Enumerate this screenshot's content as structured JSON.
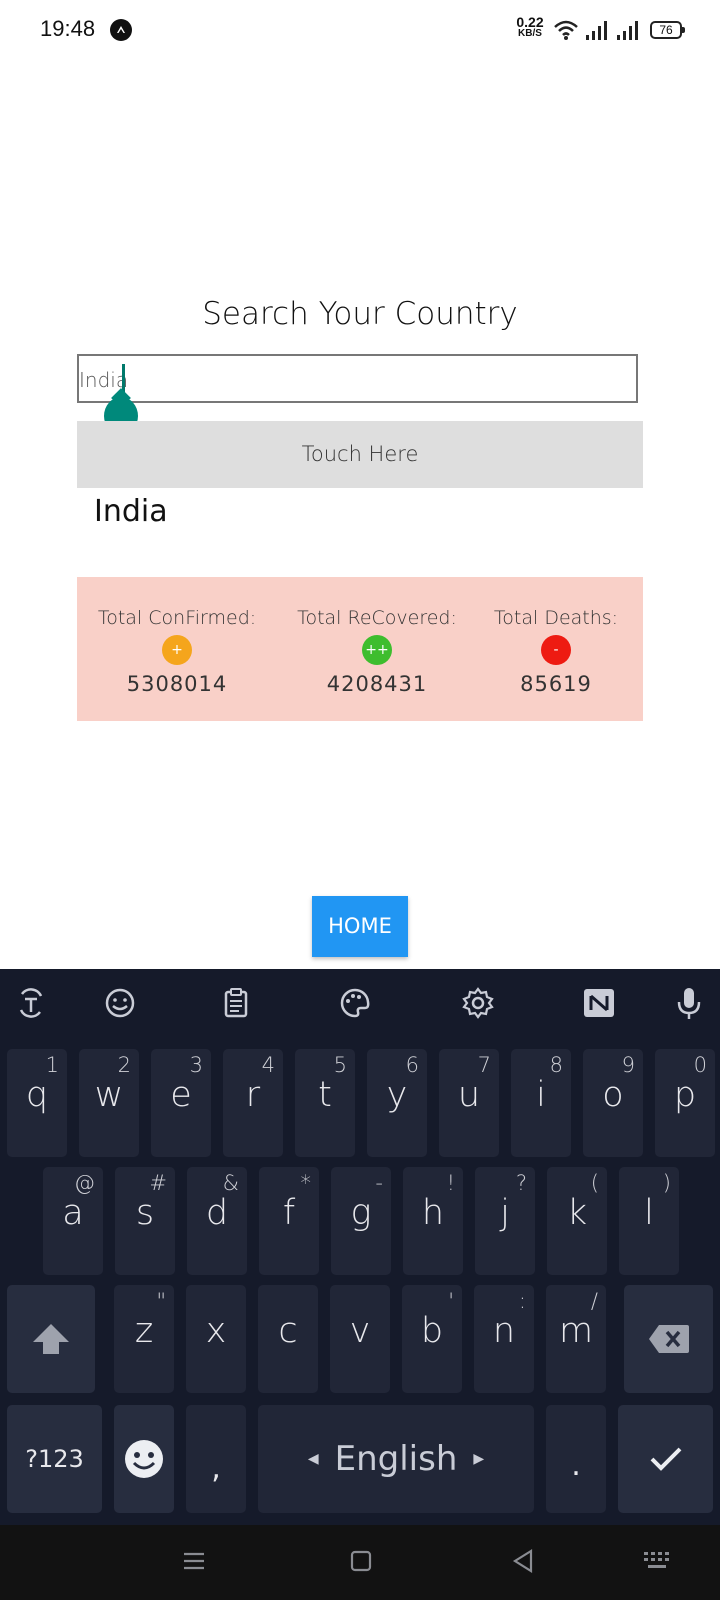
{
  "status_bar": {
    "time": "19:48",
    "speed_value": "0.22",
    "speed_unit": "KB/S",
    "battery": "76"
  },
  "app": {
    "title": "Search Your Country",
    "search": {
      "value": "India"
    },
    "touch_button": "Touch Here",
    "result_country": "India",
    "stats": [
      {
        "label": "Total ConFirmed:",
        "symbol": "+",
        "color": "#f5a51c",
        "value": "5308014"
      },
      {
        "label": "Total ReCovered:",
        "symbol": "++",
        "color": "#3ebd2e",
        "value": "4208431"
      },
      {
        "label": "Total Deaths:",
        "symbol": "-",
        "color": "#ee1b12",
        "value": "85619"
      }
    ],
    "home_button": "HOME",
    "colors": {
      "accent": "#2196f3",
      "stats_bg": "#f9d0c8",
      "caret": "#00897b"
    }
  },
  "keyboard": {
    "toolbar_icons": [
      "translate-icon",
      "emoji-icon",
      "clipboard-icon",
      "palette-icon",
      "settings-icon",
      "news-icon",
      "microphone-icon"
    ],
    "row1": [
      {
        "k": "q",
        "h": "1"
      },
      {
        "k": "w",
        "h": "2"
      },
      {
        "k": "e",
        "h": "3"
      },
      {
        "k": "r",
        "h": "4"
      },
      {
        "k": "t",
        "h": "5"
      },
      {
        "k": "y",
        "h": "6"
      },
      {
        "k": "u",
        "h": "7"
      },
      {
        "k": "i",
        "h": "8"
      },
      {
        "k": "o",
        "h": "9"
      },
      {
        "k": "p",
        "h": "0"
      }
    ],
    "row2": [
      {
        "k": "a",
        "h": "@"
      },
      {
        "k": "s",
        "h": "#"
      },
      {
        "k": "d",
        "h": "&"
      },
      {
        "k": "f",
        "h": "*"
      },
      {
        "k": "g",
        "h": "-"
      },
      {
        "k": "h",
        "h": "!"
      },
      {
        "k": "j",
        "h": "?"
      },
      {
        "k": "k",
        "h": "("
      },
      {
        "k": "l",
        "h": ")"
      }
    ],
    "row3": [
      {
        "k": "z",
        "h": "\""
      },
      {
        "k": "x",
        "h": ""
      },
      {
        "k": "c",
        "h": ""
      },
      {
        "k": "v",
        "h": ""
      },
      {
        "k": "b",
        "h": "'"
      },
      {
        "k": "n",
        "h": ":"
      },
      {
        "k": "m",
        "h": "/"
      }
    ],
    "symbols_key": "?123",
    "comma_key": ",",
    "space_label": "English",
    "period_key": "."
  }
}
